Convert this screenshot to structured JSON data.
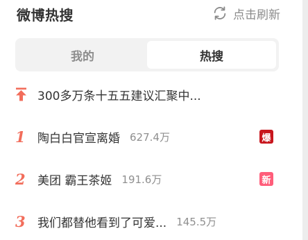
{
  "header": {
    "title": "微博热搜",
    "refresh_label": "点击刷新"
  },
  "tabs": [
    {
      "label": "我的",
      "active": false
    },
    {
      "label": "热搜",
      "active": true
    }
  ],
  "list": [
    {
      "rank": "",
      "icon": "pinned-arrow-icon",
      "topic": "300多万条十五五建议汇聚中...",
      "count": "",
      "badge": ""
    },
    {
      "rank": "1",
      "topic": "陶白白官宣离婚",
      "count": "627.4万",
      "badge": "爆"
    },
    {
      "rank": "2",
      "topic": "美团 霸王茶姬",
      "count": "191.6万",
      "badge": "新"
    },
    {
      "rank": "3",
      "topic": "我们都替他看到了可爱...",
      "count": "145.5万",
      "badge": ""
    }
  ],
  "colors": {
    "rank": "#f26d5b",
    "badge_bao": "#c8161d",
    "badge_xin": "#ff5d7a",
    "muted_text": "#8f8f8f"
  }
}
